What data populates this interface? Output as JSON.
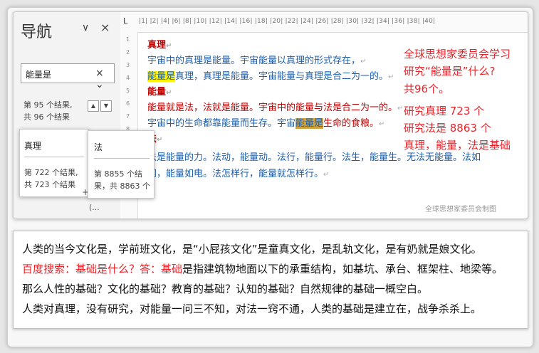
{
  "nav": {
    "title": "导航",
    "search_value": "能量是",
    "result_line1": "第 95 个结果,",
    "result_line2": "共 96 个结果",
    "card1": {
      "title": "真理",
      "count1": "第 722 个结果,",
      "count2": "共 723 个结果"
    },
    "card2": {
      "title": "法",
      "count1": "第 8855 个结",
      "count2": "果，共 8863 个"
    },
    "plus": "+",
    "ellipsis": "(..."
  },
  "ruler": {
    "corner": "L",
    "ticks": "|1|  |2|  |4|  |6|  |8|  |10|  |12|  |14|  |16|  |18|  |20|  |22|  |24|  |26|  |28|  |30|  |32|  |34|  |36|  |38|  |40|",
    "vnums": [
      "1",
      "2",
      "3",
      "4",
      "5",
      "6",
      "7",
      "8",
      "9",
      "10",
      "11",
      "12",
      "13"
    ]
  },
  "doc": {
    "h1": "真理",
    "l1": "宇宙中的真理是能量。宇宙能量以真理的形式存在，",
    "l2_hl": "能量是",
    "l2_rest": "真理，真理是能量。宇宙能量与真理是合二为一的。",
    "h2": "能量",
    "l3": "能量就是法，法就是能量。宇宙中的能量与法是合二为一的。",
    "l4_a": "宇宙中的生命都靠能量而生存。宇宙",
    "l4_hl": "能量是",
    "l4_b": "生命的食粮。",
    "h3": "法",
    "l5": "法是能量的力。法动，能量动。法行，能量行。法生，能量生。无法无能量。法如",
    "l6": "网，能量如电。法怎样行，能量就怎样行。",
    "para_mark": "↵"
  },
  "annotation": {
    "l1": "全球思想家委员会学习",
    "l2": "研究“能量是”什么?",
    "l3": "共96个。",
    "l4": "研究真理   723     个",
    "l5": "研究法是   8863    个",
    "l6": "真理，能量，法是基础"
  },
  "watermark": "全球思想家委员会制图",
  "panel": {
    "p1": "人类的当今文化是，学前班文化，是“小屁孩文化”是童真文化，是乱轨文化，是有奶就是娘文化。",
    "p2_red": "百度搜索：基础是什么？答：基础",
    "p2_rest": "是指建筑物地面以下的承重结构，如基坑、承台、框架柱、地梁等。",
    "p3": "那么人性的基础？文化的基础？教育的基础？认知的基础？自然规律的基础一概空白。",
    "p4": "人类对真理，没有研究，对能量一问三不知，对法一窍不通，人类的基础是建立在，战争杀杀上。"
  },
  "colors": {
    "accent_red": "#e8232a",
    "doc_red": "#c00000",
    "doc_blue": "#1f5fa8",
    "highlight": "#fff200"
  }
}
